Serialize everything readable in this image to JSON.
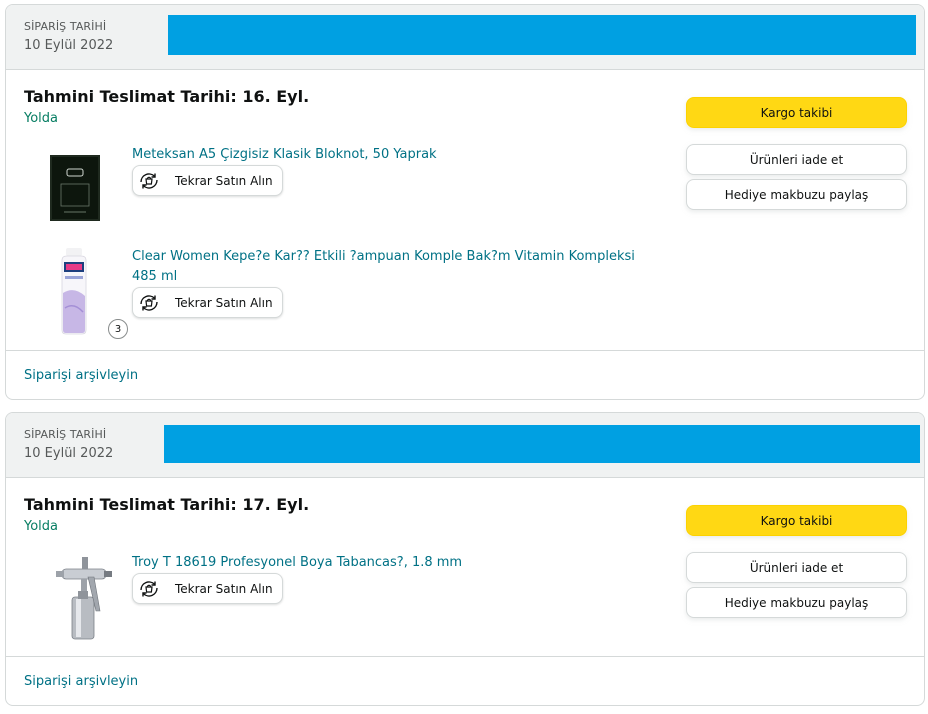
{
  "orders": [
    {
      "date_label": "SİPARİŞ TARİHİ",
      "date_value": "10 Eylül 2022",
      "delivery_title": "Tahmini Teslimat Tarihi: 16. Eyl.",
      "status": "Yolda",
      "track_button": "Kargo takibi",
      "return_button": "Ürünleri iade et",
      "gift_button": "Hediye makbuzu paylaş",
      "items": [
        {
          "name": "Meteksan A5 Çizgisiz Klasik Bloknot, 50 Yaprak",
          "rebuy_label": "Tekrar Satın Alın"
        },
        {
          "name": "Clear Women Kepe?e Kar?? Etkili ?ampuan Komple Bak?m Vitamin Kompleksi 485 ml",
          "rebuy_label": "Tekrar Satın Alın",
          "quantity": "3"
        }
      ],
      "archive_link": "Siparişi arşivleyin"
    },
    {
      "date_label": "SİPARİŞ TARİHİ",
      "date_value": "10 Eylül 2022",
      "delivery_title": "Tahmini Teslimat Tarihi: 17. Eyl.",
      "status": "Yolda",
      "track_button": "Kargo takibi",
      "return_button": "Ürünleri iade et",
      "gift_button": "Hediye makbuzu paylaş",
      "items": [
        {
          "name": "Troy T 18619 Profesyonel Boya Tabancas?, 1.8 mm",
          "rebuy_label": "Tekrar Satın Alın"
        }
      ],
      "archive_link": "Siparişi arşivleyin"
    }
  ],
  "colors": {
    "link": "#007185",
    "status_green": "#067d62",
    "primary_button": "#ffd814",
    "redaction": "#00a0e2"
  }
}
